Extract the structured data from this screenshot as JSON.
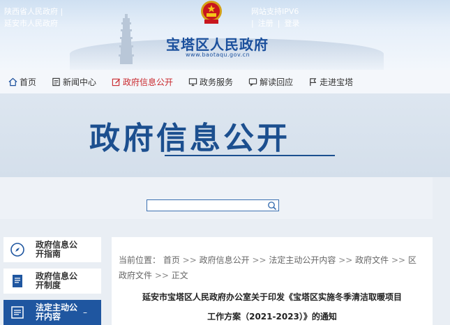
{
  "top_links": {
    "left": [
      "陕西省人民政府 |",
      "延安市人民政府"
    ],
    "ipv6": "网站支持IPV6",
    "sep": "|",
    "register": "注册",
    "sep2": "|",
    "login": "登录"
  },
  "site": {
    "title": "宝塔区人民政府",
    "url": "www.baotaqu.gov.cn"
  },
  "nav": [
    {
      "label": "首页",
      "icon": "home-icon"
    },
    {
      "label": "新闻中心",
      "icon": "news-icon"
    },
    {
      "label": "政府信息公开",
      "icon": "edit-icon",
      "active": true
    },
    {
      "label": "政务服务",
      "icon": "monitor-icon"
    },
    {
      "label": "解读回应",
      "icon": "chat-icon"
    },
    {
      "label": "走进宝塔",
      "icon": "flag-icon"
    }
  ],
  "hero": {
    "title": "政府信息公开"
  },
  "search": {
    "placeholder": ""
  },
  "sidebar": [
    {
      "label": "政府信息公开指南",
      "icon": "compass-icon"
    },
    {
      "label": "政府信息公开制度",
      "icon": "document-icon"
    },
    {
      "label": "法定主动公开内容",
      "icon": "list-icon",
      "active": true,
      "suffix": "–"
    }
  ],
  "breadcrumb": {
    "prefix": "当前位置：",
    "items": [
      "首页",
      "政府信息公开",
      "法定主动公开内容",
      "政府文件",
      "区政府文件",
      "正文"
    ],
    "sep": " >> "
  },
  "article": {
    "title_line1": "延安市宝塔区人民政府办公室关于印发《宝塔区实施冬季清洁取暖项目",
    "title_line2": "工作方案（2021-2023）》的通知"
  },
  "colors": {
    "brand": "#1a4f9c",
    "active_nav": "#c9282d",
    "sidebar_active": "#1f56a0"
  }
}
